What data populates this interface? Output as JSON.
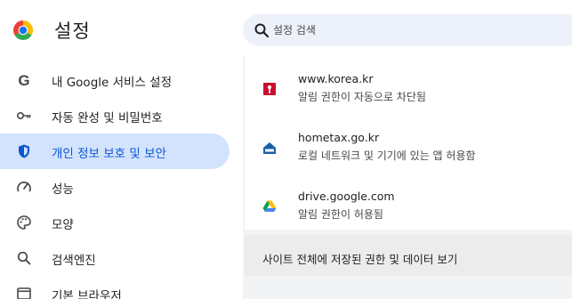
{
  "header": {
    "title": "설정",
    "search_placeholder": "설정 검색"
  },
  "sidebar": {
    "items": [
      {
        "label": "내 Google 서비스 설정",
        "icon": "google-g-icon"
      },
      {
        "label": "자동 완성 및 비밀번호",
        "icon": "key-icon"
      },
      {
        "label": "개인 정보 보호 및 보안",
        "icon": "shield-icon",
        "active": true
      },
      {
        "label": "성능",
        "icon": "speedometer-icon"
      },
      {
        "label": "모양",
        "icon": "palette-icon"
      },
      {
        "label": "검색엔진",
        "icon": "search-icon"
      },
      {
        "label": "기본 브라우저",
        "icon": "browser-window-icon"
      }
    ]
  },
  "main": {
    "sites": [
      {
        "name": "www.korea.kr",
        "description": "알림 권한이 자동으로 차단됨",
        "icon": "korea-site-icon"
      },
      {
        "name": "hometax.go.kr",
        "description": "로컬 네트워크 및 기기에 있는 앱 허용함",
        "icon": "hometax-site-icon"
      },
      {
        "name": "drive.google.com",
        "description": "알림 권한이 허용됨",
        "icon": "google-drive-icon"
      }
    ],
    "view_all_label": "사이트 전체에 저장된 권한 및 데이터 보기"
  },
  "colors": {
    "active_bg": "#d3e3fd",
    "active_text": "#0b57d0",
    "search_bg": "#edf2fa",
    "main_bg": "#f1f3f4"
  }
}
